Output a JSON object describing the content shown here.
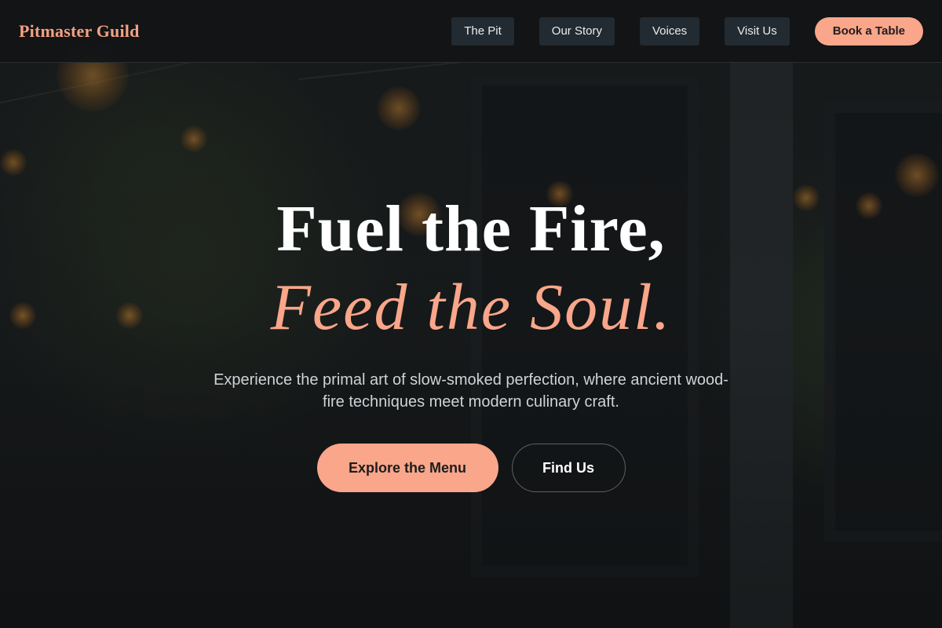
{
  "header": {
    "brand": "Pitmaster Guild",
    "nav": [
      {
        "label": "The Pit"
      },
      {
        "label": "Our Story"
      },
      {
        "label": "Voices"
      },
      {
        "label": "Visit Us"
      }
    ],
    "cta_label": "Book a Table"
  },
  "hero": {
    "title_line1": "Fuel the Fire,",
    "title_line2": "Feed the Soul.",
    "subtitle": "Experience the primal art of slow-smoked perfection, where ancient wood-fire techniques meet modern culinary craft.",
    "primary_button": "Explore the Menu",
    "secondary_button": "Find Us"
  },
  "colors": {
    "accent": "#f9a68a",
    "brand": "#f4a183",
    "nav_bg": "#222b31",
    "background": "#121517"
  }
}
